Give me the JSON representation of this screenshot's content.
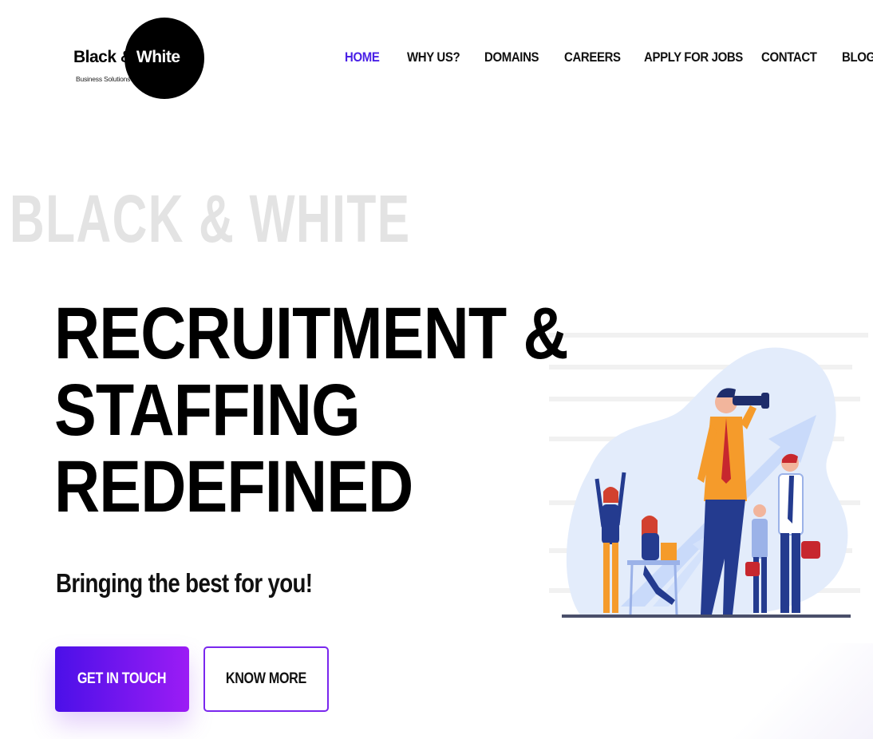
{
  "logo": {
    "brand_black": "Black &",
    "brand_white": "White",
    "tagline": "Business Solutions"
  },
  "nav": {
    "items": [
      {
        "label": "HOME",
        "active": true
      },
      {
        "label": "WHY US?"
      },
      {
        "label": "DOMAINS"
      },
      {
        "label": "CAREERS"
      },
      {
        "label": "APPLY FOR JOBS"
      },
      {
        "label": "CONTACT"
      },
      {
        "label": "BLOG"
      }
    ]
  },
  "hero": {
    "watermark": "BLACK & WHITE",
    "headline_line1": "RECRUITMENT &",
    "headline_line2": "STAFFING",
    "headline_line3": "REDEFINED",
    "subtitle": "Bringing the best for you!",
    "primary_button": "GET IN TOUCH",
    "secondary_button": "KNOW MORE"
  },
  "colors": {
    "accent": "#4a21e6",
    "gradient_start": "#4b10e8",
    "gradient_end": "#9c1cf5",
    "watermark": "#e3e3e3"
  },
  "illustration": {
    "icon": "recruitment-team-illustration"
  }
}
